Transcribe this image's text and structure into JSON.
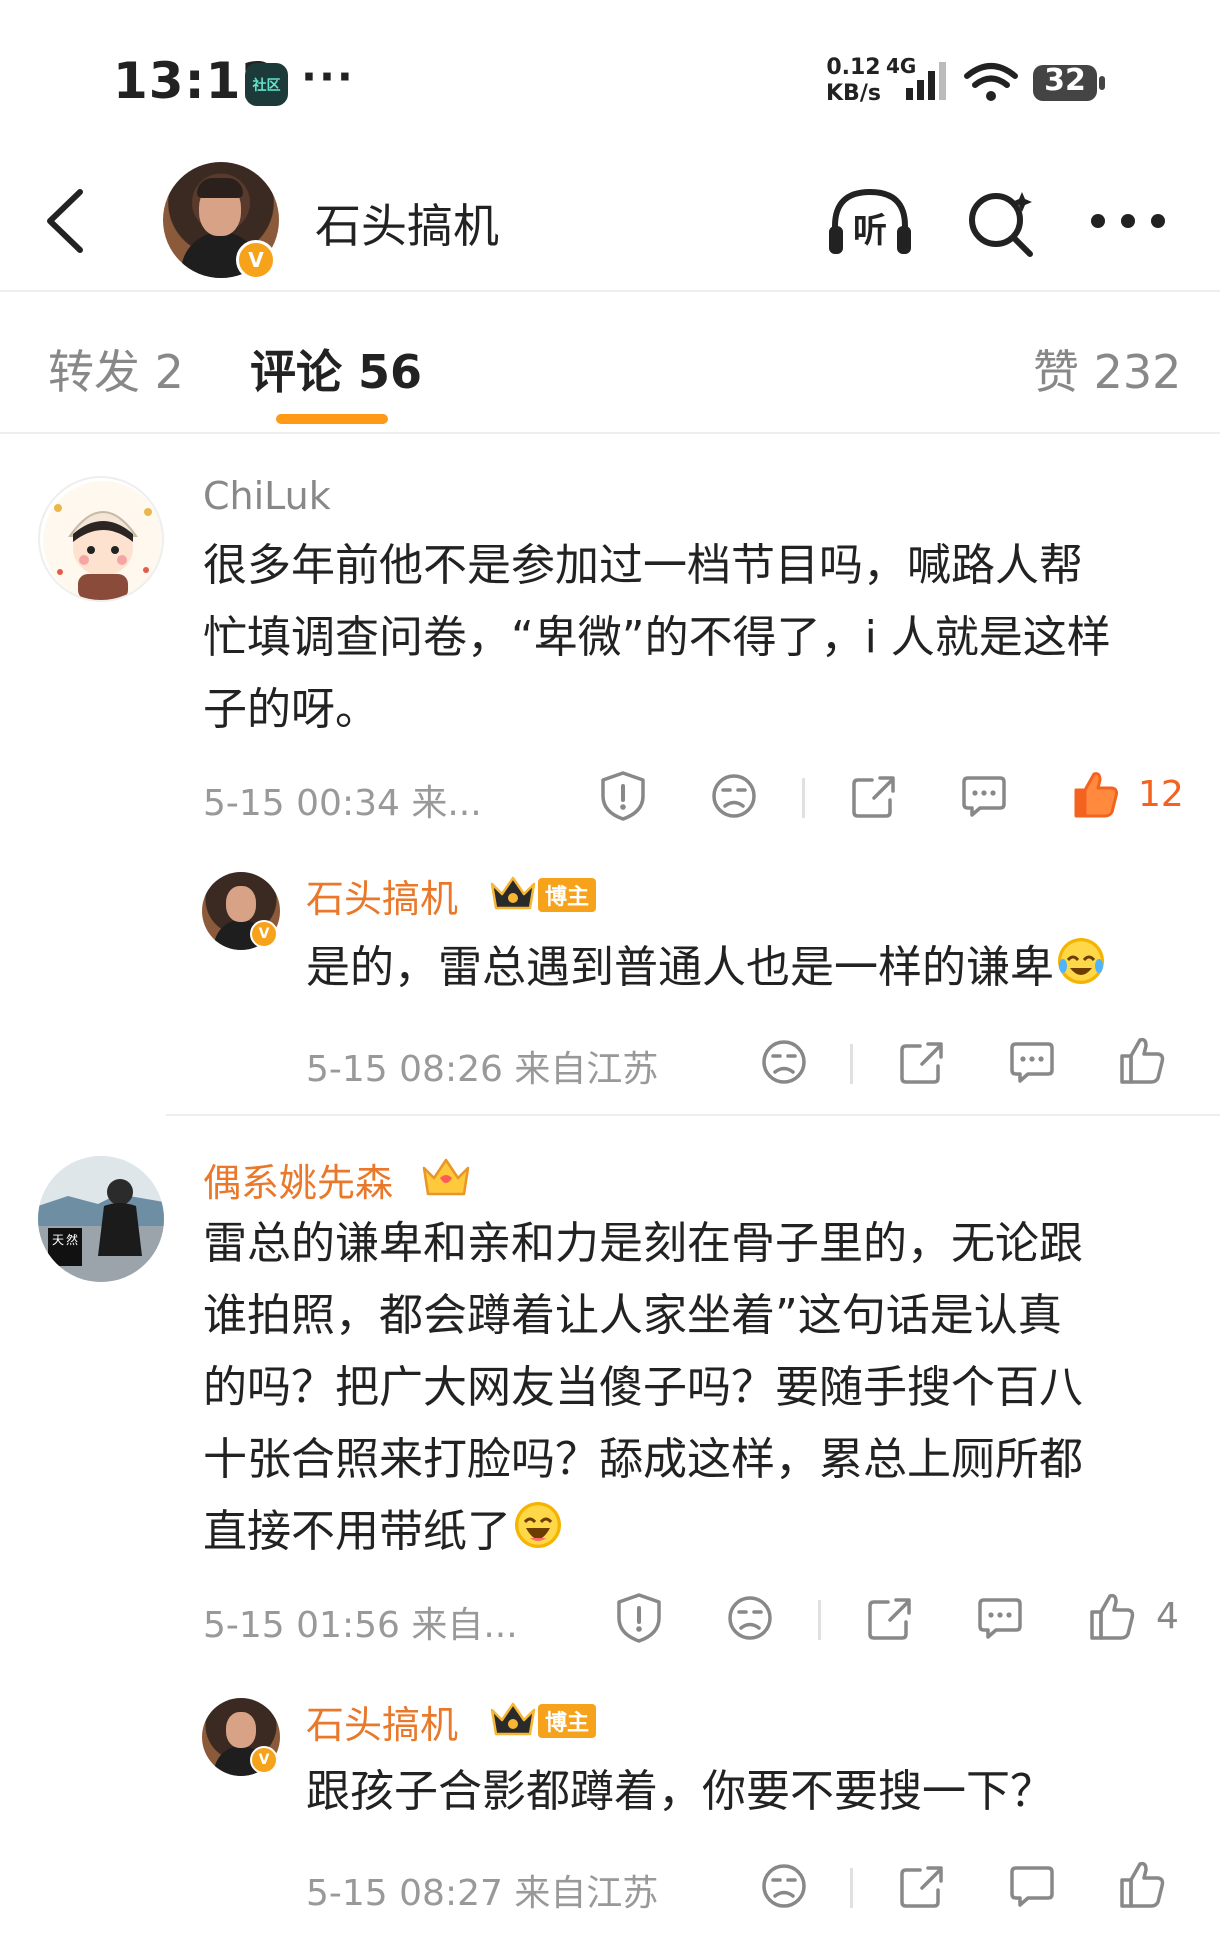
{
  "status_bar": {
    "time": "13:12",
    "app_badge": "社区",
    "dots": "···",
    "speed_value": "0.12",
    "speed_unit": "KB/s",
    "network": "4G",
    "battery": "32"
  },
  "header": {
    "title": "石头搞机",
    "listen_label": "听"
  },
  "tabs": {
    "repost": "转发 2",
    "comments": "评论 56",
    "likes": "赞 232"
  },
  "comments": [
    {
      "user": "ChiLuk",
      "text_lines": [
        "很多年前他不是参加过一档节目吗，喊路人帮",
        "忙填调查问卷，“卑微”的不得了，i 人就是这样",
        "子的呀。"
      ],
      "meta": "5-15 00:34 来...",
      "likes": "12",
      "reply": {
        "user": "石头搞机",
        "badge": "博主",
        "text": "是的，雷总遇到普通人也是一样的谦卑",
        "meta": "5-15 08:26 来自江苏"
      }
    },
    {
      "user": "偶系姚先森",
      "text_lines": [
        "雷总的谦卑和亲和力是刻在骨子里的，无论跟",
        "谁拍照，都会蹲着让人家坐着”这句话是认真",
        "的吗？把广大网友当傻子吗？要随手搜个百八",
        "十张合照来打脸吗？舔成这样，累总上厕所都",
        "直接不用带纸了"
      ],
      "meta": "5-15 01:56 来自...",
      "likes": "4",
      "reply": {
        "user": "石头搞机",
        "badge": "博主",
        "text": "跟孩子合影都蹲着，你要不要搜一下？",
        "meta": "5-15 08:27 来自江苏"
      }
    }
  ],
  "colors": {
    "accent_orange": "#ff9a17",
    "username_orange": "#e9782a",
    "like_hot": "#f4621f",
    "verified_badge": "#f7a21b"
  }
}
